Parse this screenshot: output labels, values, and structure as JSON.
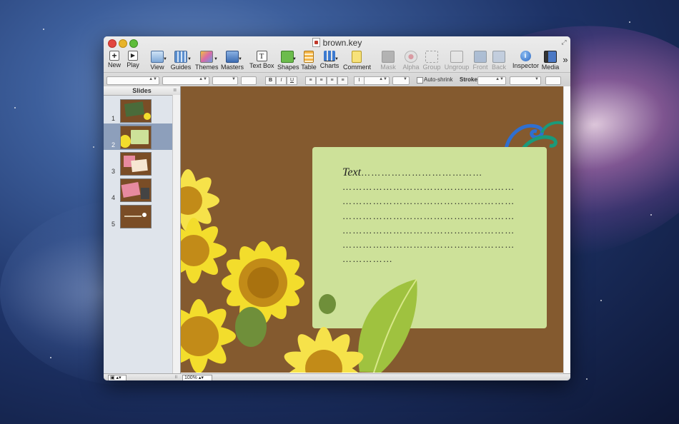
{
  "window": {
    "title": "brown.key"
  },
  "toolbar": {
    "left": [
      {
        "label": "New",
        "icon": "plus-icon"
      },
      {
        "label": "Play",
        "icon": "play-icon"
      }
    ],
    "middle": [
      {
        "label": "View",
        "icon": "view-icon"
      },
      {
        "label": "Guides",
        "icon": "guides-icon"
      },
      {
        "label": "Themes",
        "icon": "themes-icon"
      },
      {
        "label": "Masters",
        "icon": "masters-icon"
      },
      {
        "label": "Text Box",
        "icon": "text-box-icon"
      },
      {
        "label": "Shapes",
        "icon": "shapes-icon"
      },
      {
        "label": "Table",
        "icon": "table-icon"
      },
      {
        "label": "Charts",
        "icon": "charts-icon"
      },
      {
        "label": "Comment",
        "icon": "comment-icon"
      }
    ],
    "disabled": [
      {
        "label": "Mask",
        "icon": "mask-icon"
      },
      {
        "label": "Alpha",
        "icon": "alpha-icon"
      },
      {
        "label": "Group",
        "icon": "group-icon"
      },
      {
        "label": "Ungroup",
        "icon": "ungroup-icon"
      },
      {
        "label": "Front",
        "icon": "front-icon"
      },
      {
        "label": "Back",
        "icon": "back-icon"
      }
    ],
    "right": [
      {
        "label": "Inspector",
        "icon": "inspector-icon"
      },
      {
        "label": "Media",
        "icon": "media-icon"
      }
    ],
    "overflow": "»"
  },
  "format_bar": {
    "bold": "B",
    "italic": "I",
    "underline": "U",
    "auto_shrink_label": "Auto-shrink",
    "stroke_label": "Stroke:"
  },
  "sidebar": {
    "header": "Slides",
    "slides": [
      {
        "number": "1"
      },
      {
        "number": "2",
        "selected": true
      },
      {
        "number": "3"
      },
      {
        "number": "4"
      },
      {
        "number": "5"
      }
    ]
  },
  "slide": {
    "title": "Text",
    "title_dots": "………………………………",
    "dotted_lines": [
      "……………………………………………",
      "……………………………………………",
      "……………………………………………",
      "……………………………………………",
      "……………………………………………",
      "……………"
    ],
    "colors": {
      "background": "#845a2f",
      "card": "#cde199",
      "flower": "#f3dd2c",
      "leaf": "#9fc23f",
      "swirl_blue": "#2f6fd0",
      "swirl_teal": "#1a9a7a"
    }
  },
  "status_bar": {
    "zoom": "100%"
  }
}
